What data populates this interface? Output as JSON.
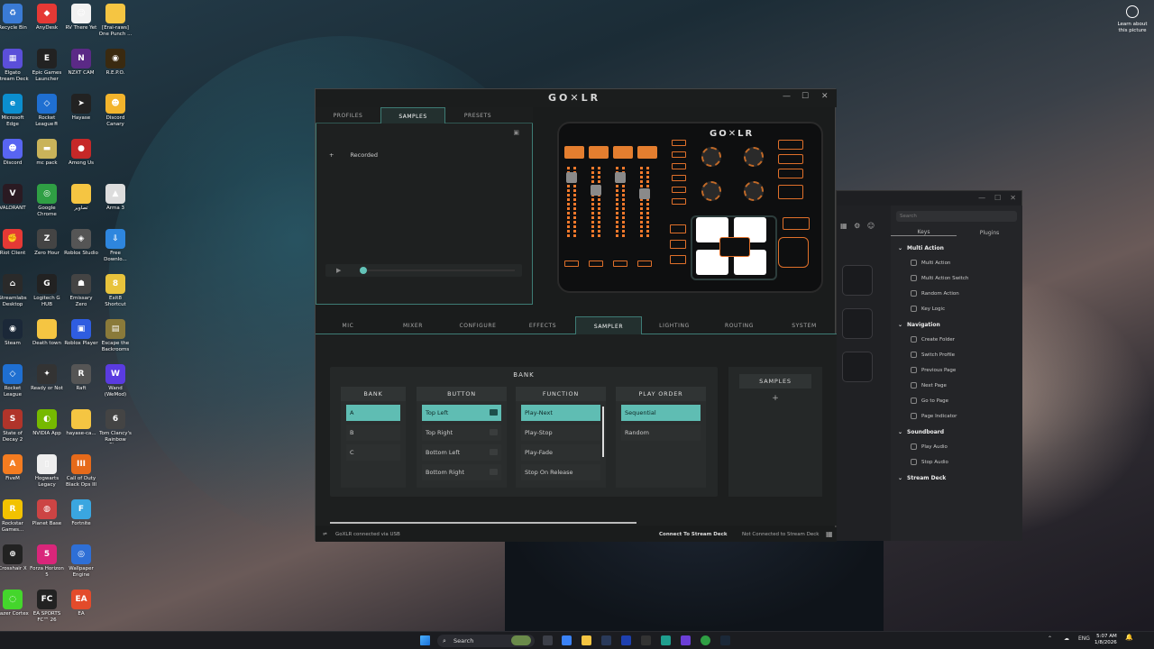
{
  "desktop": {
    "icons": [
      {
        "label": "Recycle Bin",
        "color": "#3a7bd5",
        "glyph": "♻"
      },
      {
        "label": "AnyDesk",
        "color": "#e53935",
        "glyph": "◆"
      },
      {
        "label": "RV There Yet",
        "color": "#f2f2f2",
        "glyph": "☺"
      },
      {
        "label": "[Erai-raws] One Punch ...",
        "color": "#f5c542",
        "glyph": ""
      },
      {
        "label": "Elgato Stream Deck",
        "color": "#5b4fd9",
        "glyph": "▦"
      },
      {
        "label": "Epic Games Launcher",
        "color": "#222",
        "glyph": "E"
      },
      {
        "label": "NZXT CAM",
        "color": "#5b2a86",
        "glyph": "N"
      },
      {
        "label": "R.E.P.O.",
        "color": "#3a2a10",
        "glyph": "◉"
      },
      {
        "label": "Microsoft Edge",
        "color": "#0b8ecf",
        "glyph": "e"
      },
      {
        "label": "Rocket League®",
        "color": "#1f6fd1",
        "glyph": "◇"
      },
      {
        "label": "Hayase",
        "color": "#222",
        "glyph": "➤"
      },
      {
        "label": "Discord Canary",
        "color": "#f3b42c",
        "glyph": "☻"
      },
      {
        "label": "Discord",
        "color": "#5865f2",
        "glyph": "☻"
      },
      {
        "label": "mc pack",
        "color": "#c9b35a",
        "glyph": "▬"
      },
      {
        "label": "Among Us",
        "color": "#c62828",
        "glyph": "●"
      },
      {
        "label": "",
        "color": "transparent",
        "glyph": ""
      },
      {
        "label": "VALORANT",
        "color": "#2a1a22",
        "glyph": "V"
      },
      {
        "label": "Google Chrome",
        "color": "#2f9f44",
        "glyph": "◎"
      },
      {
        "label": "تصاویر",
        "color": "#f5c542",
        "glyph": ""
      },
      {
        "label": "Arma 3",
        "color": "#ddd",
        "glyph": "▲"
      },
      {
        "label": "Riot Client",
        "color": "#e53935",
        "glyph": "✊"
      },
      {
        "label": "Zero Hour",
        "color": "#444",
        "glyph": "Z"
      },
      {
        "label": "Roblox Studio",
        "color": "#555",
        "glyph": "◈"
      },
      {
        "label": "Free Downlo...",
        "color": "#2e86de",
        "glyph": "⇩"
      },
      {
        "label": "Streamlabs Desktop",
        "color": "#2a2a2a",
        "glyph": "⌂"
      },
      {
        "label": "Logitech G HUB",
        "color": "#222",
        "glyph": "G"
      },
      {
        "label": "Emissary Zero",
        "color": "#444",
        "glyph": "☗"
      },
      {
        "label": "Exit8 Shortcut",
        "color": "#e8c33c",
        "glyph": "8"
      },
      {
        "label": "Steam",
        "color": "#1b2838",
        "glyph": "◉"
      },
      {
        "label": "Death town",
        "color": "#f5c542",
        "glyph": ""
      },
      {
        "label": "Roblox Player",
        "color": "#2f5de0",
        "glyph": "▣"
      },
      {
        "label": "Escape the Backrooms",
        "color": "#8a7a3a",
        "glyph": "▤"
      },
      {
        "label": "Rocket League",
        "color": "#1f6fd1",
        "glyph": "◇"
      },
      {
        "label": "Ready or Not",
        "color": "#333",
        "glyph": "✦"
      },
      {
        "label": "Raft",
        "color": "#555",
        "glyph": "R"
      },
      {
        "label": "Wand (WeMod)",
        "color": "#5a3be0",
        "glyph": "W"
      },
      {
        "label": "State of Decay 2",
        "color": "#b0342a",
        "glyph": "S"
      },
      {
        "label": "NVIDIA App",
        "color": "#76b900",
        "glyph": "◐"
      },
      {
        "label": "hayase-ca...",
        "color": "#f5c542",
        "glyph": ""
      },
      {
        "label": "Tom Clancy's Rainbow Six...",
        "color": "#444",
        "glyph": "6"
      },
      {
        "label": "FiveM",
        "color": "#f47c20",
        "glyph": "A"
      },
      {
        "label": "Hogwarts Legacy",
        "color": "#eee",
        "glyph": "▯"
      },
      {
        "label": "Call of Duty Black Ops III",
        "color": "#e66a1a",
        "glyph": "III"
      },
      {
        "label": "",
        "color": "transparent",
        "glyph": ""
      },
      {
        "label": "Rockstar Games...",
        "color": "#f2c200",
        "glyph": "R"
      },
      {
        "label": "Planet Base",
        "color": "#c44",
        "glyph": "◍"
      },
      {
        "label": "Fortnite",
        "color": "#3aa6e0",
        "glyph": "F"
      },
      {
        "label": "",
        "color": "transparent",
        "glyph": ""
      },
      {
        "label": "Crosshair X",
        "color": "#222",
        "glyph": "⊕"
      },
      {
        "label": "Forza Horizon 5",
        "color": "#d9267a",
        "glyph": "5"
      },
      {
        "label": "Wallpaper Engine",
        "color": "#2e6fd6",
        "glyph": "◎"
      },
      {
        "label": "",
        "color": "transparent",
        "glyph": ""
      },
      {
        "label": "Razer Cortex",
        "color": "#44d62c",
        "glyph": "◌"
      },
      {
        "label": "EA SPORTS FC™ 26",
        "color": "#222",
        "glyph": "FC"
      },
      {
        "label": "EA",
        "color": "#e34b2b",
        "glyph": "EA"
      },
      {
        "label": "",
        "color": "transparent",
        "glyph": ""
      }
    ],
    "learn_more": "Learn about this picture"
  },
  "goxlr": {
    "logo": "GO✕LR",
    "window_controls": {
      "minimize": "—",
      "maximize": "☐",
      "close": "✕"
    },
    "profile_tabs": [
      "PROFILES",
      "SAMPLES",
      "PRESETS"
    ],
    "samples_list": [
      {
        "add": "+",
        "label": "Recorded"
      }
    ],
    "device_logo": "GO✕LR",
    "main_tabs": [
      "MIC",
      "MIXER",
      "CONFIGURE",
      "EFFECTS",
      "SAMPLER",
      "LIGHTING",
      "ROUTING",
      "SYSTEM"
    ],
    "active_main_tab": "SAMPLER",
    "bank_title": "BANK",
    "columns": {
      "bank": {
        "head": "BANK",
        "items": [
          "A",
          "B",
          "C"
        ],
        "selected": 0
      },
      "button": {
        "head": "BUTTON",
        "items": [
          "Top Left",
          "Top Right",
          "Bottom Left",
          "Bottom Right"
        ],
        "selected": 0
      },
      "function": {
        "head": "FUNCTION",
        "items": [
          "Play-Next",
          "Play-Stop",
          "Play-Fade",
          "Stop On Release"
        ],
        "selected": 0
      },
      "play_order": {
        "head": "PLAY ORDER",
        "items": [
          "Sequential",
          "Random"
        ],
        "selected": 0
      }
    },
    "samples_head": "SAMPLES",
    "samples_add": "+",
    "status": {
      "usb": "GoXLR connected via USB",
      "connect": "Connect To Stream Deck",
      "not_connected": "Not Connected to Stream Deck"
    },
    "accent": "#5fbdb3",
    "orange": "#f2792b"
  },
  "streamdeck": {
    "search_placeholder": "Search",
    "tabs": [
      "Keys",
      "Plugins"
    ],
    "groups": [
      {
        "name": "Multi Action",
        "items": [
          "Multi Action",
          "Multi Action Switch",
          "Random Action",
          "Key Logic"
        ]
      },
      {
        "name": "Navigation",
        "items": [
          "Create Folder",
          "Switch Profile",
          "Previous Page",
          "Next Page",
          "Go to Page",
          "Page Indicator"
        ]
      },
      {
        "name": "Soundboard",
        "items": [
          "Play Audio",
          "Stop Audio"
        ]
      },
      {
        "name": "Stream Deck",
        "items": []
      }
    ]
  },
  "taskbar": {
    "search": "Search",
    "lang": "ENG",
    "time": "5:07 AM",
    "date": "1/8/2026"
  }
}
